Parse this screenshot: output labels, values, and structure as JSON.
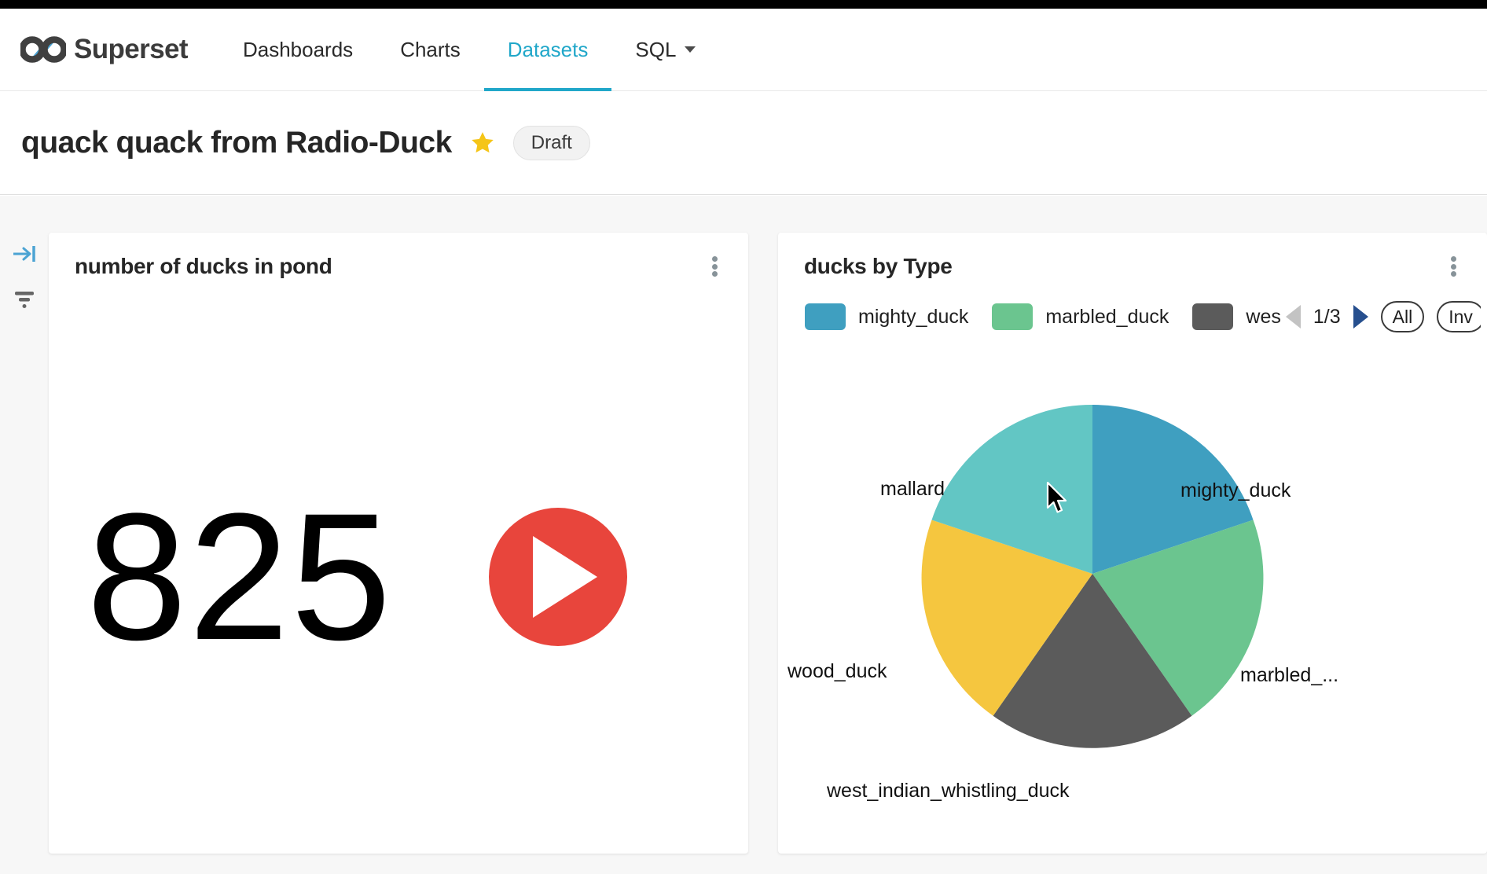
{
  "navbar": {
    "brand": "Superset",
    "logo_icon": "infinity-logo-icon",
    "links": [
      {
        "label": "Dashboards",
        "active": false
      },
      {
        "label": "Charts",
        "active": false
      },
      {
        "label": "Datasets",
        "active": true
      },
      {
        "label": "SQL",
        "active": false,
        "has_caret": true
      }
    ],
    "accent_color": "#20a7c9"
  },
  "dashboard_header": {
    "title": "quack quack from Radio-Duck",
    "star_icon": "star-icon",
    "star_color": "#f5c518",
    "badge": "Draft"
  },
  "rail": {
    "expand_icon": "expand-panel-icon",
    "expand_color": "#4ba3d3",
    "filter_icon": "filter-funnel-icon",
    "filter_color": "#666666"
  },
  "cards": [
    {
      "title": "number of ducks in pond",
      "menu_icon": "kebab-menu-icon",
      "big_number": "825",
      "play_icon": "play-button-icon",
      "play_color": "#e8453c"
    },
    {
      "title": "ducks by Type",
      "menu_icon": "kebab-menu-icon"
    }
  ],
  "legend": {
    "items": [
      {
        "label": "mighty_duck",
        "color": "#3f9fc0"
      },
      {
        "label": "marbled_duck",
        "color": "#6bc58f"
      },
      {
        "label": "wes",
        "color": "#5b5b5b",
        "truncated": true
      }
    ],
    "prev_icon": "chevron-left-icon",
    "next_icon": "chevron-right-icon",
    "page_indicator": "1/3",
    "select_all_label": "All",
    "invert_label": "Inv"
  },
  "chart_data": {
    "type": "pie",
    "title": "ducks by Type",
    "labels": [
      "mighty_duck",
      "marbled_...",
      "west_indian_whistling_duck",
      "wood_duck",
      "mallard"
    ],
    "full_labels": [
      "mighty_duck",
      "marbled_duck",
      "west_indian_whistling_duck",
      "wood_duck",
      "mallard"
    ],
    "values": [
      20,
      20,
      20,
      20,
      20
    ],
    "colors": [
      "#3f9fc0",
      "#6bc58f",
      "#5b5b5b",
      "#f4c githubd43",
      "#63c5c3"
    ],
    "slice_colors": [
      "#3f9fc0",
      "#6bc58f",
      "#5b5b5b",
      "#f5c63f",
      "#62c6c4"
    ],
    "start_angle_deg": 0,
    "direction": "clockwise",
    "legend_position": "top",
    "labels_position": "outside"
  },
  "cursor": {
    "icon": "mouse-pointer-icon"
  }
}
